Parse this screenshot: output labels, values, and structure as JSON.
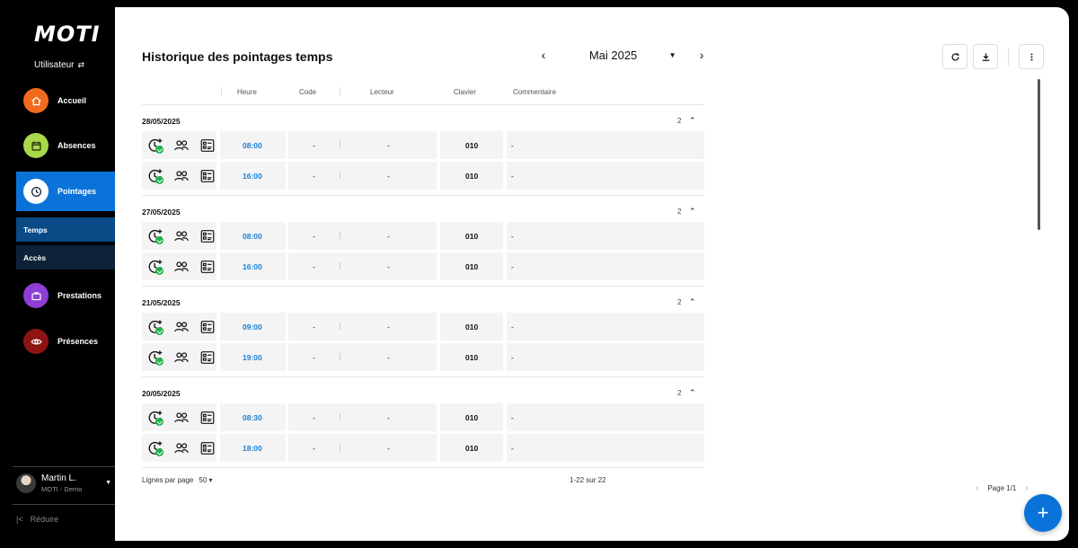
{
  "app": {
    "logo": "MOTI",
    "role": "Utilisateur",
    "role_icon": "swap-icon"
  },
  "nav": {
    "items": [
      {
        "label": "Accueil",
        "icon": "home-icon",
        "color": "#f26b1d"
      },
      {
        "label": "Absences",
        "icon": "calendar-icon",
        "color": "#a8d94a"
      },
      {
        "label": "Pointages",
        "icon": "clock-icon",
        "color": "#ffffff"
      },
      {
        "label": "Prestations",
        "icon": "briefcase-icon",
        "color": "#8f3fd8"
      },
      {
        "label": "Présences",
        "icon": "eye-icon",
        "color": "#8e1414"
      }
    ],
    "sub_items": [
      {
        "label": "Temps"
      },
      {
        "label": "Accès"
      }
    ],
    "accent": "#0a73d9"
  },
  "profile": {
    "name": "Martin L.",
    "subtitle": "MOTI - Demo"
  },
  "reduce_label": "Réduire",
  "page": {
    "title": "Historique des pointages temps",
    "month": "Mai 2025"
  },
  "table": {
    "columns": [
      "Heure",
      "Code",
      "Lecteur",
      "Clavier",
      "Commentaire"
    ],
    "groups": [
      {
        "date": "28/05/2025",
        "count": "2",
        "rows": [
          {
            "time": "08:00",
            "code": "-",
            "lecteur": "-",
            "clavier": "010",
            "comment": "-"
          },
          {
            "time": "16:00",
            "code": "-",
            "lecteur": "-",
            "clavier": "010",
            "comment": "-"
          }
        ]
      },
      {
        "date": "27/05/2025",
        "count": "2",
        "rows": [
          {
            "time": "08:00",
            "code": "-",
            "lecteur": "-",
            "clavier": "010",
            "comment": "-"
          },
          {
            "time": "16:00",
            "code": "-",
            "lecteur": "-",
            "clavier": "010",
            "comment": "-"
          }
        ]
      },
      {
        "date": "21/05/2025",
        "count": "2",
        "rows": [
          {
            "time": "09:00",
            "code": "-",
            "lecteur": "-",
            "clavier": "010",
            "comment": "-"
          },
          {
            "time": "19:00",
            "code": "-",
            "lecteur": "-",
            "clavier": "010",
            "comment": "-"
          }
        ]
      },
      {
        "date": "20/05/2025",
        "count": "2",
        "rows": [
          {
            "time": "08:30",
            "code": "-",
            "lecteur": "-",
            "clavier": "010",
            "comment": "-"
          },
          {
            "time": "18:00",
            "code": "-",
            "lecteur": "-",
            "clavier": "010",
            "comment": "-"
          }
        ]
      }
    ]
  },
  "footer": {
    "rows_per_page_label": "Lignes par page",
    "rows_per_page_value": "50",
    "range": "1-22 sur 22",
    "page": "Page 1/1"
  }
}
